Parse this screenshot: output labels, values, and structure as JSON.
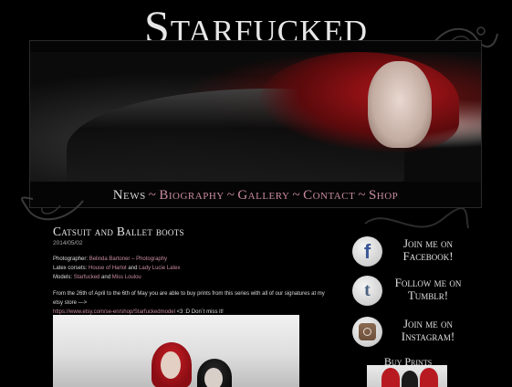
{
  "site": {
    "title": "Starfucked"
  },
  "nav": {
    "items": [
      "News",
      "Biography",
      "Gallery",
      "Contact",
      "Shop"
    ],
    "separator": "~"
  },
  "post": {
    "title": "Catsuit and Ballet boots",
    "date": "2014/05/02",
    "photographer_label": "Photographer:",
    "photographer": "Belinda Bartoner – Photography",
    "latex_label": "Latex corsets:",
    "latex_1": "House of Harlot",
    "latex_and": "and",
    "latex_2": "Lady Lucie Latex",
    "models_label": "Models:",
    "model_1": "Starfucked",
    "models_and": "and",
    "model_2": "Miss Loulou",
    "body": "From the 26th of April to the 6th of May you are able to buy prints from this series with all of our signatures at my etsy store —>",
    "etsy_link": "https://www.etsy.com/se-en/shop/Starfuckedmodel",
    "body_end": "<3  :D Don´t miss it!"
  },
  "sidebar": {
    "facebook": {
      "label": "Join me on Facebook!",
      "icon": "facebook-icon"
    },
    "tumblr": {
      "label": "Follow me on Tumblr!",
      "icon": "tumblr-icon"
    },
    "instagram": {
      "label": "Join me on Instagram!",
      "icon": "instagram-icon"
    },
    "buy_prints": "Buy Prints"
  },
  "colors": {
    "background": "#000000",
    "accent_pink": "#c78aa0",
    "text": "#dddddd"
  }
}
